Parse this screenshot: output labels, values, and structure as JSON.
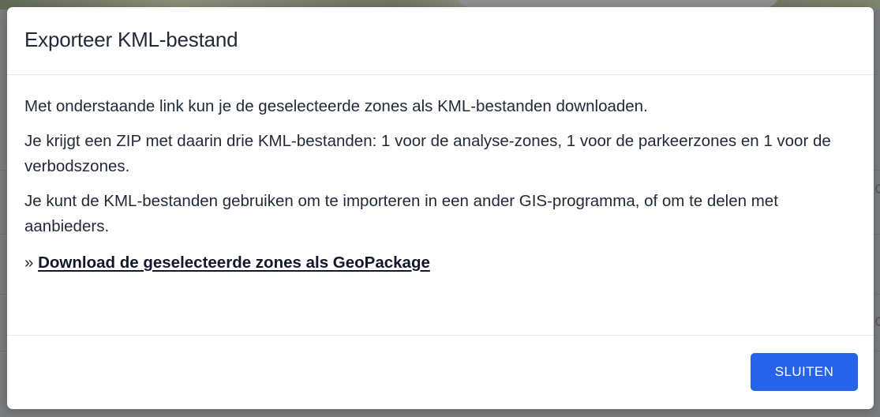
{
  "modal": {
    "title": "Exporteer KML-bestand",
    "paragraphs": [
      "Met onderstaande link kun je de geselecteerde zones als KML-bestanden downloaden.",
      "Je krijgt een ZIP met daarin drie KML-bestanden: 1 voor de analyse-zones, 1 voor de parkeerzones en 1 voor de verbodszones.",
      "Je kunt de KML-bestanden gebruiken om te importeren in een ander GIS-programma, of om te delen met aanbieders."
    ],
    "link_prefix": "»",
    "download_link_label": "Download de geselecteerde zones als GeoPackage",
    "close_button_label": "SLUITEN"
  },
  "colors": {
    "primary_button": "#2563eb",
    "text": "#1f2937",
    "backdrop": "#7a7d80"
  }
}
